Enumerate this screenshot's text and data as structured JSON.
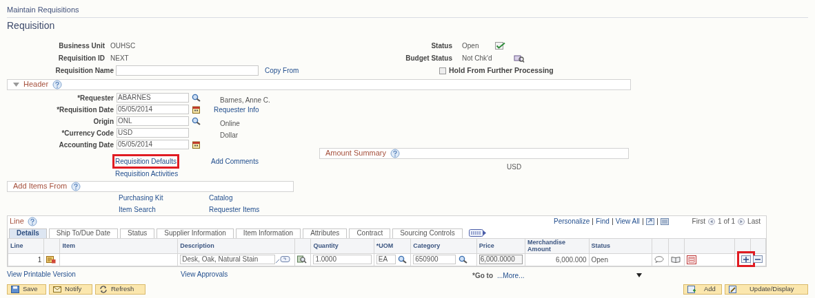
{
  "breadcrumb": "Maintain Requisitions",
  "page_title": "Requisition",
  "summary_left": [
    {
      "label": "Business Unit",
      "value": "OUHSC"
    },
    {
      "label": "Requisition ID",
      "value": "NEXT"
    }
  ],
  "summary_right": [
    {
      "label": "Status",
      "value": "Open",
      "kind": "approved"
    },
    {
      "label": "Budget Status",
      "value": "Not Chk'd",
      "kind": "budget"
    }
  ],
  "requisition_name": {
    "label": "Requisition Name",
    "link": "Copy From"
  },
  "hold_checkbox": {
    "label": "Hold From Further Processing",
    "checked": false
  },
  "header_section": {
    "title": "Header",
    "expanded": true,
    "fields": [
      {
        "label": "*Requester",
        "value": "ABARNES",
        "kind": "lookup",
        "description": "Barnes, Anne C."
      },
      {
        "label": "*Requisition Date",
        "value": "05/05/2014",
        "kind": "date",
        "link": "Requester Info"
      },
      {
        "label": "Origin",
        "value": "ONL",
        "kind": "lookup",
        "description": "Online"
      },
      {
        "label": "*Currency Code",
        "value": "USD",
        "kind": "plain",
        "description": "Dollar"
      },
      {
        "label": "Accounting Date",
        "value": "05/05/2014",
        "kind": "date"
      }
    ],
    "links": [
      {
        "text": "Requisition Defaults",
        "highlighted": true
      },
      {
        "text": "Add Comments",
        "highlighted": false
      },
      {
        "text": "Requisition Activities",
        "highlighted": false
      }
    ]
  },
  "amount_summary": {
    "title": "Amount Summary",
    "currency": "USD"
  },
  "add_items_from": {
    "title": "Add Items From",
    "links": [
      "Purchasing Kit",
      "Catalog",
      "Item Search",
      "Requester Items"
    ]
  },
  "line_grid": {
    "title": "Line",
    "toolbar": [
      "Personalize",
      "Find",
      "View All"
    ],
    "first": "First",
    "page": "1 of 1",
    "last": "Last",
    "tabs": [
      {
        "label": "Details",
        "selected": true
      },
      {
        "label": "Ship To/Due Date",
        "selected": false
      },
      {
        "label": "Status",
        "selected": false
      },
      {
        "label": "Supplier Information",
        "selected": false
      },
      {
        "label": "Item Information",
        "selected": false
      },
      {
        "label": "Attributes",
        "selected": false
      },
      {
        "label": "Contract",
        "selected": false
      },
      {
        "label": "Sourcing Controls",
        "selected": false
      }
    ],
    "columns": [
      "Line",
      "Item",
      "Description",
      "Quantity",
      "*UOM",
      "Category",
      "Price",
      "Merchandise Amount",
      "Status"
    ],
    "rows": [
      {
        "line": "1",
        "description": "Desk, Oak, Natural Stain",
        "quantity": "1.0000",
        "uom": "EA",
        "category": "650900",
        "price": "6,000.0000",
        "amount": "6,000.000",
        "status": "Open",
        "add_highlighted": true
      }
    ]
  },
  "bottom_links": [
    "View Printable Version",
    "View Approvals"
  ],
  "goto": {
    "label": "*Go to",
    "value": "...More..."
  },
  "buttons_left": [
    {
      "label": "Save",
      "kind": "save"
    },
    {
      "label": "Notify",
      "kind": "notify"
    },
    {
      "label": "Refresh",
      "kind": "refresh"
    }
  ],
  "buttons_right": [
    {
      "label": "Add",
      "kind": "add"
    },
    {
      "label": "Update/Display",
      "kind": "update"
    }
  ]
}
